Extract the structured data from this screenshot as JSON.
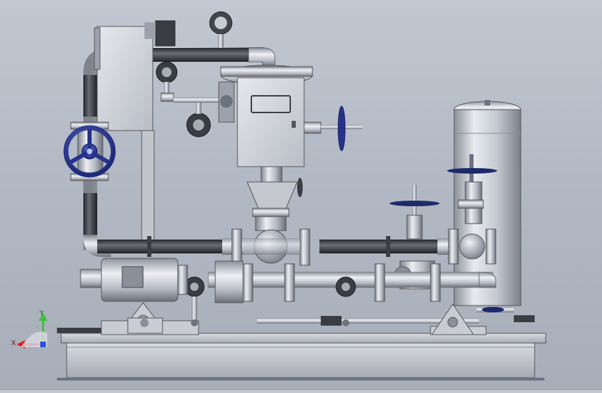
{
  "triad": {
    "y_label": "Y",
    "x_label": "X",
    "y_color": "#3fbf3f",
    "x_color": "#e02020",
    "z_color": "#2850e0"
  },
  "colors": {
    "steel": "#b4b8c2",
    "steel_dark": "#6d7280",
    "pipe_dark": "#3b3d44",
    "valve_blue": "#2e3f9a",
    "frame": "#c6c9d2",
    "background": "#b8bec8"
  },
  "components": [
    "control-cabinet",
    "pump-motor",
    "pressure-tank",
    "gate-valves",
    "handwheel-valve",
    "base-frame",
    "piping"
  ]
}
